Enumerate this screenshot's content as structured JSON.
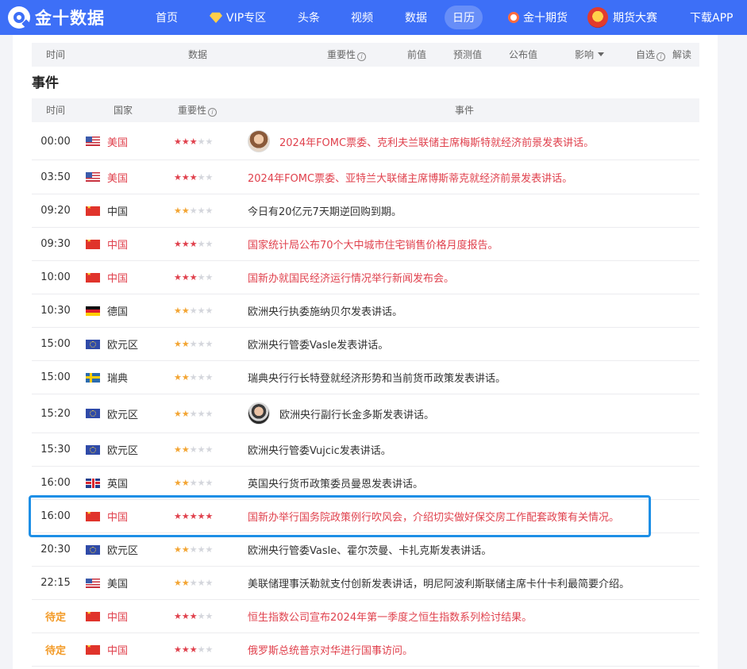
{
  "brand": {
    "name": "金十数据",
    "primary_color": "#3d6ff7"
  },
  "nav": {
    "items": [
      {
        "label": "首页",
        "icon": ""
      },
      {
        "label": "VIP专区",
        "icon": "diamond-icon"
      },
      {
        "label": "头条",
        "icon": ""
      },
      {
        "label": "视频",
        "icon": ""
      },
      {
        "label": "数据",
        "icon": ""
      },
      {
        "label": "日历",
        "icon": "",
        "active": true
      },
      {
        "label": "金十期货",
        "icon": "futures-logo-icon"
      },
      {
        "label": "期货大赛",
        "icon": "contest-badge-icon"
      },
      {
        "label": "下载APP",
        "icon": ""
      }
    ]
  },
  "data_table": {
    "headers": {
      "time": "时间",
      "data": "数据",
      "importance": "重要性",
      "previous": "前值",
      "forecast": "预测值",
      "actual": "公布值",
      "impact": "影响",
      "watch": "自选",
      "explain": "解读"
    }
  },
  "events": {
    "title": "事件",
    "headers": {
      "time": "时间",
      "country": "国家",
      "importance": "重要性",
      "event": "事件"
    },
    "rows": [
      {
        "time": "00:00",
        "flag": "us",
        "country": "美国",
        "stars": 3,
        "avatar": "av-1",
        "red": true,
        "event": "2024年FOMC票委、克利夫兰联储主席梅斯特就经济前景发表讲话。"
      },
      {
        "time": "03:50",
        "flag": "us",
        "country": "美国",
        "stars": 3,
        "avatar": "",
        "red": true,
        "event": "2024年FOMC票委、亚特兰大联储主席博斯蒂克就经济前景发表讲话。"
      },
      {
        "time": "09:20",
        "flag": "cn",
        "country": "中国",
        "stars": 2,
        "avatar": "",
        "red": false,
        "event": "今日有20亿元7天期逆回购到期。"
      },
      {
        "time": "09:30",
        "flag": "cn",
        "country": "中国",
        "stars": 3,
        "avatar": "",
        "red": true,
        "event": "国家统计局公布70个大中城市住宅销售价格月度报告。"
      },
      {
        "time": "10:00",
        "flag": "cn",
        "country": "中国",
        "stars": 3,
        "avatar": "",
        "red": true,
        "event": "国新办就国民经济运行情况举行新闻发布会。"
      },
      {
        "time": "10:30",
        "flag": "de",
        "country": "德国",
        "stars": 2,
        "avatar": "",
        "red": false,
        "event": "欧洲央行执委施纳贝尔发表讲话。"
      },
      {
        "time": "15:00",
        "flag": "eu",
        "country": "欧元区",
        "stars": 2,
        "avatar": "",
        "red": false,
        "event": "欧洲央行管委Vasle发表讲话。"
      },
      {
        "time": "15:00",
        "flag": "se",
        "country": "瑞典",
        "stars": 2,
        "avatar": "",
        "red": false,
        "event": "瑞典央行行长特登就经济形势和当前货币政策发表讲话。"
      },
      {
        "time": "15:20",
        "flag": "eu",
        "country": "欧元区",
        "stars": 2,
        "avatar": "av-2",
        "red": false,
        "event": "欧洲央行副行长金多斯发表讲话。"
      },
      {
        "time": "15:30",
        "flag": "eu",
        "country": "欧元区",
        "stars": 2,
        "avatar": "",
        "red": false,
        "event": "欧洲央行管委Vujcic发表讲话。"
      },
      {
        "time": "16:00",
        "flag": "uk",
        "country": "英国",
        "stars": 2,
        "avatar": "",
        "red": false,
        "event": "英国央行货币政策委员曼恩发表讲话。"
      },
      {
        "time": "16:00",
        "flag": "cn",
        "country": "中国",
        "stars": 5,
        "avatar": "",
        "red": true,
        "event": "国新办举行国务院政策例行吹风会，介绍切实做好保交房工作配套政策有关情况。"
      },
      {
        "time": "20:30",
        "flag": "eu",
        "country": "欧元区",
        "stars": 2,
        "avatar": "",
        "red": false,
        "event": "欧洲央行管委Vasle、霍尔茨曼、卡扎克斯发表讲话。"
      },
      {
        "time": "22:15",
        "flag": "us",
        "country": "美国",
        "stars": 2,
        "avatar": "",
        "red": false,
        "event": "美联储理事沃勒就支付创新发表讲话，明尼阿波利斯联储主席卡什卡利最简要介绍。"
      },
      {
        "time": "待定",
        "flag": "cn",
        "country": "中国",
        "stars": 3,
        "avatar": "",
        "red": true,
        "pending": true,
        "event": "恒生指数公司宣布2024年第一季度之恒生指数系列检讨结果。"
      },
      {
        "time": "待定",
        "flag": "cn",
        "country": "中国",
        "stars": 3,
        "avatar": "",
        "red": true,
        "pending": true,
        "event": "俄罗斯总统普京对华进行国事访问。"
      }
    ]
  }
}
